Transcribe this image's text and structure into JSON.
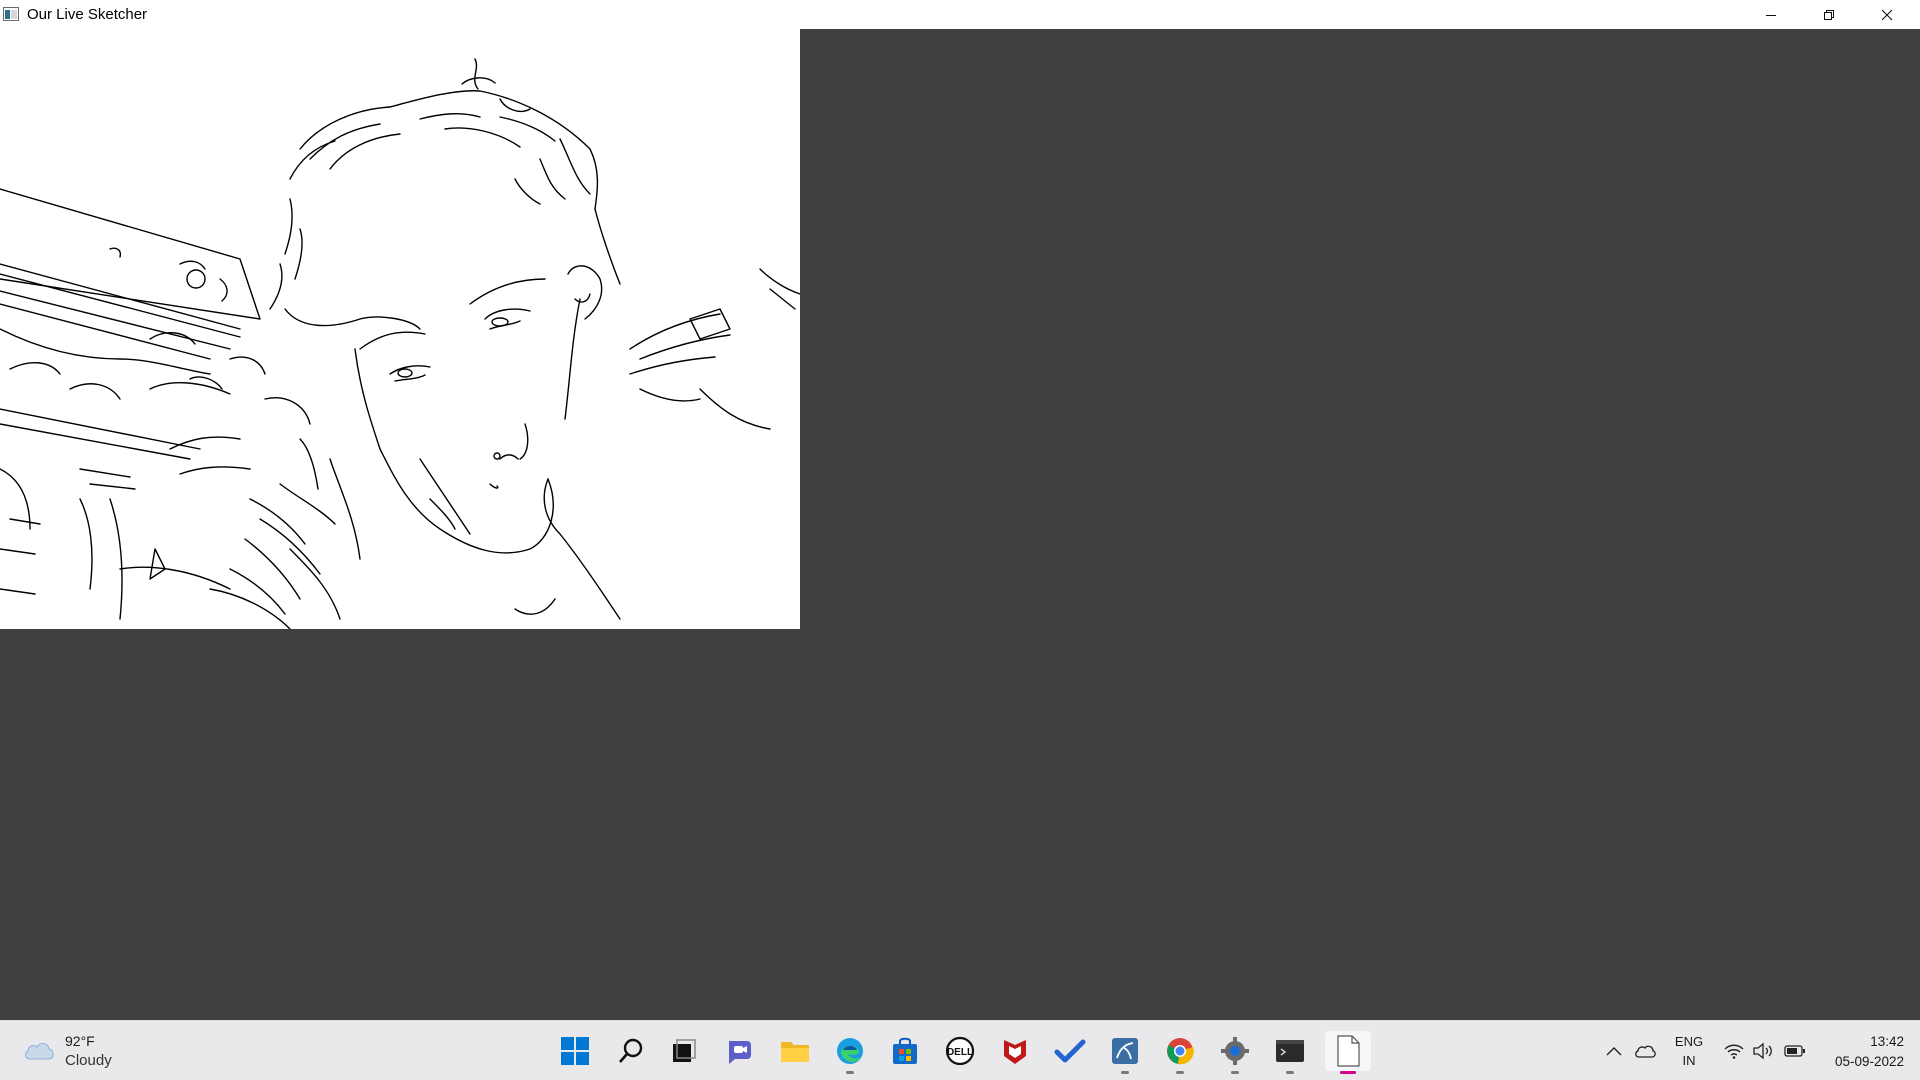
{
  "window": {
    "title": "Our Live Sketcher",
    "controls": {
      "minimize": "minimize-icon",
      "maximize": "restore-icon",
      "close": "close-icon"
    }
  },
  "sketch": {
    "description_colors": {
      "background": "#ffffff",
      "lines": "#000000"
    }
  },
  "taskbar": {
    "weather": {
      "temperature": "92°F",
      "condition": "Cloudy",
      "icon": "cloud-icon"
    },
    "apps": [
      {
        "name": "start",
        "icon": "windows-logo-icon"
      },
      {
        "name": "search",
        "icon": "search-icon"
      },
      {
        "name": "task-view",
        "icon": "task-view-icon"
      },
      {
        "name": "chat",
        "icon": "teams-chat-icon"
      },
      {
        "name": "file-explorer",
        "icon": "folder-icon"
      },
      {
        "name": "edge",
        "icon": "edge-icon",
        "running": true
      },
      {
        "name": "store",
        "icon": "store-icon"
      },
      {
        "name": "dell",
        "icon": "dell-icon"
      },
      {
        "name": "mcafee",
        "icon": "mcafee-icon"
      },
      {
        "name": "todo",
        "icon": "checkmark-icon"
      },
      {
        "name": "mysql",
        "icon": "mysql-icon",
        "running": true
      },
      {
        "name": "chrome",
        "icon": "chrome-icon",
        "running": true
      },
      {
        "name": "settings",
        "icon": "gear-icon",
        "running": true
      },
      {
        "name": "terminal",
        "icon": "terminal-icon",
        "running": true
      },
      {
        "name": "sketch-window",
        "icon": "blank-page-icon",
        "active": true
      }
    ],
    "tray": {
      "language_primary": "ENG",
      "language_secondary": "IN",
      "time": "13:42",
      "date": "05-09-2022"
    }
  },
  "colors": {
    "desktop": "#404040",
    "taskbar": "#e9e9ec",
    "accent_pink": "#d3008c",
    "win_blue": "#0078d4"
  }
}
